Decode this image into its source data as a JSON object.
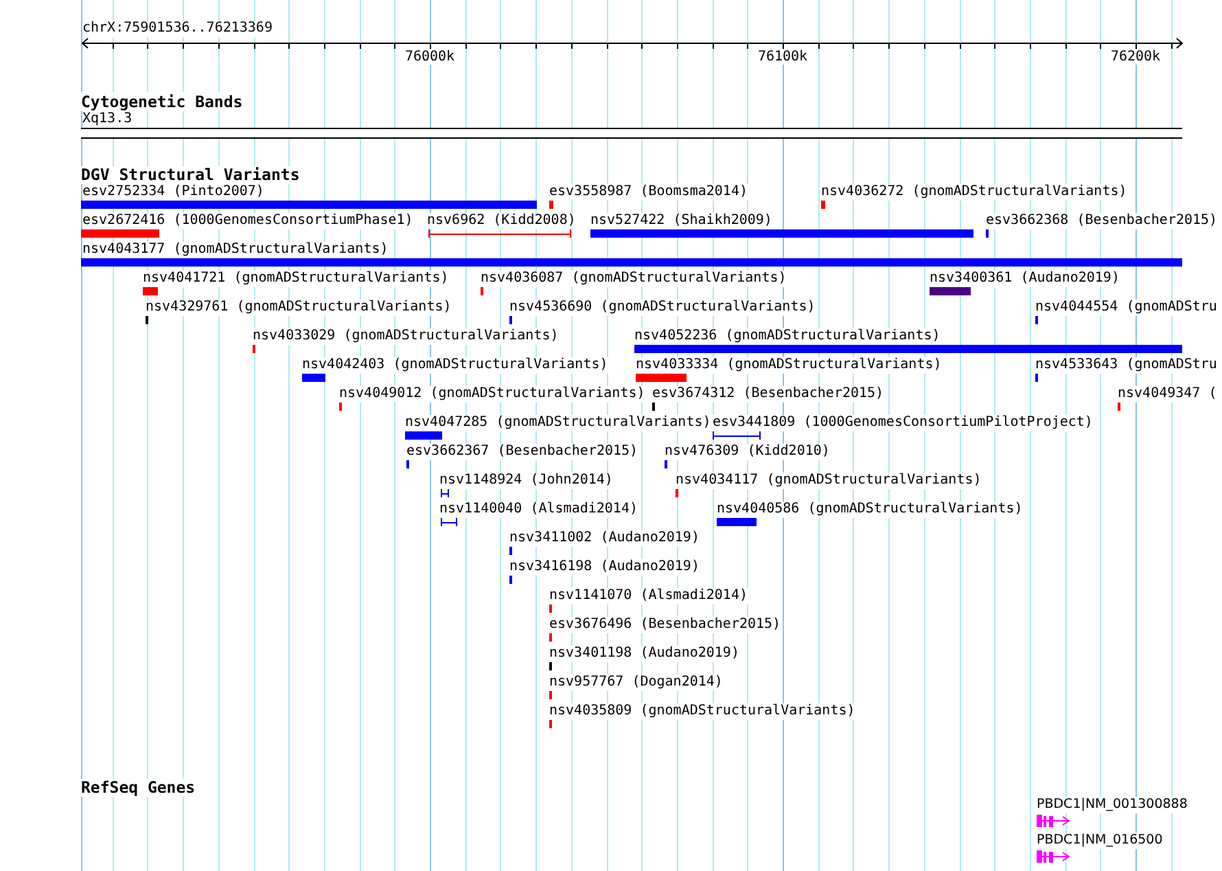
{
  "ruler": {
    "location": "chrX:75901536..76213369",
    "ticks": [
      "76000k",
      "76100k",
      "76200k"
    ]
  },
  "cytogenetic_bands": {
    "title": "Cytogenetic Bands",
    "band": "Xq13.3"
  },
  "dgv_structural_variants": {
    "title": "DGV Structural Variants",
    "features": [
      {
        "label": "esv2752334 (Pinto2007)",
        "kind": "bar",
        "color": "#0000ff"
      },
      {
        "label": "esv3558987 (Boomsma2014)",
        "kind": "bar",
        "color": "#ff0000"
      },
      {
        "label": "nsv4036272 (gnomADStructuralVariants)",
        "kind": "bar",
        "color": "#ff0000"
      },
      {
        "label": "esv2672416 (1000GenomesConsortiumPhase1)",
        "kind": "bar",
        "color": "#ff0000"
      },
      {
        "label": "nsv6962 (Kidd2008)",
        "kind": "span",
        "color": "#ff0000"
      },
      {
        "label": "nsv527422 (Shaikh2009)",
        "kind": "bar",
        "color": "#0000ff"
      },
      {
        "label": "esv3662368 (Besenbacher2015)",
        "kind": "bar",
        "color": "#0000ff"
      },
      {
        "label": "nsv4043177 (gnomADStructuralVariants)",
        "kind": "bar",
        "color": "#0000ff"
      },
      {
        "label": "nsv4041721 (gnomADStructuralVariants)",
        "kind": "bar",
        "color": "#ff0000"
      },
      {
        "label": "nsv4036087 (gnomADStructuralVariants)",
        "kind": "bar",
        "color": "#ff0000"
      },
      {
        "label": "nsv3400361 (Audano2019)",
        "kind": "bar",
        "color": "#4b0082"
      },
      {
        "label": "nsv4329761 (gnomADStructuralVariants)",
        "kind": "bar",
        "color": "#000000"
      },
      {
        "label": "nsv4536690 (gnomADStructuralVariants)",
        "kind": "bar",
        "color": "#0000ff"
      },
      {
        "label": "nsv4044554 (gnomADStru",
        "kind": "bar",
        "color": "#0000ff"
      },
      {
        "label": "nsv4033029 (gnomADStructuralVariants)",
        "kind": "bar",
        "color": "#ff0000"
      },
      {
        "label": "nsv4052236 (gnomADStructuralVariants)",
        "kind": "bar",
        "color": "#0000ff"
      },
      {
        "label": "nsv4042403 (gnomADStructuralVariants)",
        "kind": "bar",
        "color": "#0000ff"
      },
      {
        "label": "nsv4033334 (gnomADStructuralVariants)",
        "kind": "bar",
        "color": "#ff0000"
      },
      {
        "label": "nsv4533643 (gnomADStru",
        "kind": "bar",
        "color": "#0000ff"
      },
      {
        "label": "nsv4049012 (gnomADStructuralVariants)",
        "kind": "bar",
        "color": "#ff0000"
      },
      {
        "label": "esv3674312 (Besenbacher2015)",
        "kind": "bar",
        "color": "#000000"
      },
      {
        "label": "nsv4049347 (",
        "kind": "bar",
        "color": "#ff0000"
      },
      {
        "label": "nsv4047285 (gnomADStructuralVariants)",
        "kind": "bar",
        "color": "#0000ff"
      },
      {
        "label": "esv3441809 (1000GenomesConsortiumPilotProject)",
        "kind": "span",
        "color": "#0000ff"
      },
      {
        "label": "esv3662367 (Besenbacher2015)",
        "kind": "bar",
        "color": "#0000ff"
      },
      {
        "label": "nsv476309 (Kidd2010)",
        "kind": "bar",
        "color": "#0000ff"
      },
      {
        "label": "nsv1148924 (John2014)",
        "kind": "span",
        "color": "#0000ff"
      },
      {
        "label": "nsv4034117 (gnomADStructuralVariants)",
        "kind": "bar",
        "color": "#ff0000"
      },
      {
        "label": "nsv1140040 (Alsmadi2014)",
        "kind": "span",
        "color": "#0000ff"
      },
      {
        "label": "nsv4040586 (gnomADStructuralVariants)",
        "kind": "bar",
        "color": "#0000ff"
      },
      {
        "label": "nsv3411002 (Audano2019)",
        "kind": "bar",
        "color": "#0000ff"
      },
      {
        "label": "nsv3416198 (Audano2019)",
        "kind": "bar",
        "color": "#0000ff"
      },
      {
        "label": "nsv1141070 (Alsmadi2014)",
        "kind": "bar",
        "color": "#ff0000"
      },
      {
        "label": "esv3676496 (Besenbacher2015)",
        "kind": "bar",
        "color": "#ff0000"
      },
      {
        "label": "nsv3401198 (Audano2019)",
        "kind": "bar",
        "color": "#000000"
      },
      {
        "label": "nsv957767 (Dogan2014)",
        "kind": "bar",
        "color": "#ff0000"
      },
      {
        "label": "nsv4035809 (gnomADStructuralVariants)",
        "kind": "bar",
        "color": "#ff0000"
      }
    ]
  },
  "refseq_genes": {
    "title": "RefSeq Genes",
    "genes": [
      {
        "label": "PBDC1|NM_001300888"
      },
      {
        "label": "PBDC1|NM_016500"
      }
    ]
  }
}
